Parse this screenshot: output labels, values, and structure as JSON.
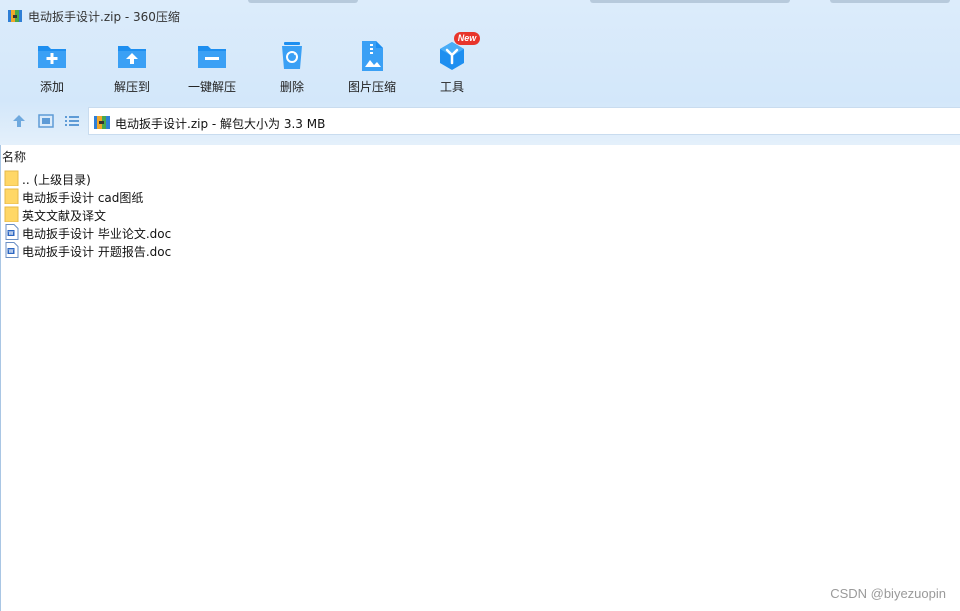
{
  "window": {
    "title": "电动扳手设计.zip - 360压缩"
  },
  "toolbar": {
    "items": [
      {
        "label": "添加",
        "icon": "add-folder-icon"
      },
      {
        "label": "解压到",
        "icon": "extract-to-icon"
      },
      {
        "label": "一键解压",
        "icon": "one-click-extract-icon"
      },
      {
        "label": "删除",
        "icon": "recycle-bin-icon"
      },
      {
        "label": "图片压缩",
        "icon": "image-compress-icon"
      },
      {
        "label": "工具",
        "icon": "tools-cube-icon"
      }
    ],
    "new_badge": "New"
  },
  "address_bar": {
    "path": "电动扳手设计.zip - 解包大小为 3.3 MB"
  },
  "file_list": {
    "column_name": "名称",
    "rows": [
      {
        "name": ".. (上级目录)",
        "type": "folder"
      },
      {
        "name": "电动扳手设计 cad图纸",
        "type": "folder"
      },
      {
        "name": "英文文献及译文",
        "type": "folder"
      },
      {
        "name": "电动扳手设计 毕业论文.doc",
        "type": "doc"
      },
      {
        "name": "电动扳手设计 开题报告.doc",
        "type": "doc"
      }
    ]
  },
  "watermark": "CSDN @biyezuopin",
  "colors": {
    "accent": "#1e8ff0",
    "toolbar_bg": "#d6e9fb",
    "folder": "#ffd766",
    "badge": "#e8352b"
  }
}
